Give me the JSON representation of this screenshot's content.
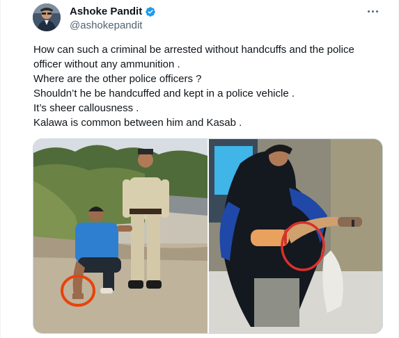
{
  "author": {
    "display_name": "Ashoke Pandit",
    "handle": "@ashokepandit",
    "verified": true,
    "avatar_icon": "profile-photo",
    "verified_icon": "verified-badge-icon",
    "verified_color": "#1d9bf0"
  },
  "menu": {
    "icon": "more-options-icon"
  },
  "tweet": {
    "lines": [
      "How can such a criminal be arrested without handcuffs and the police officer without any ammunition .",
      "Where are the other police officers ?",
      "Shouldn’t he be handcuffed and kept in a police vehicle .",
      "It’s sheer callousness .",
      "Kalawa is common between him and Kasab ."
    ]
  },
  "media": {
    "images": [
      {
        "description_icon": "photo-arrest-scene",
        "highlight_color": "#e8430a"
      },
      {
        "description_icon": "photo-kasab",
        "highlight_color": "#d9312a"
      }
    ]
  },
  "colors": {
    "text": "#0f1419",
    "secondary": "#536471",
    "border": "#cfd9de"
  }
}
